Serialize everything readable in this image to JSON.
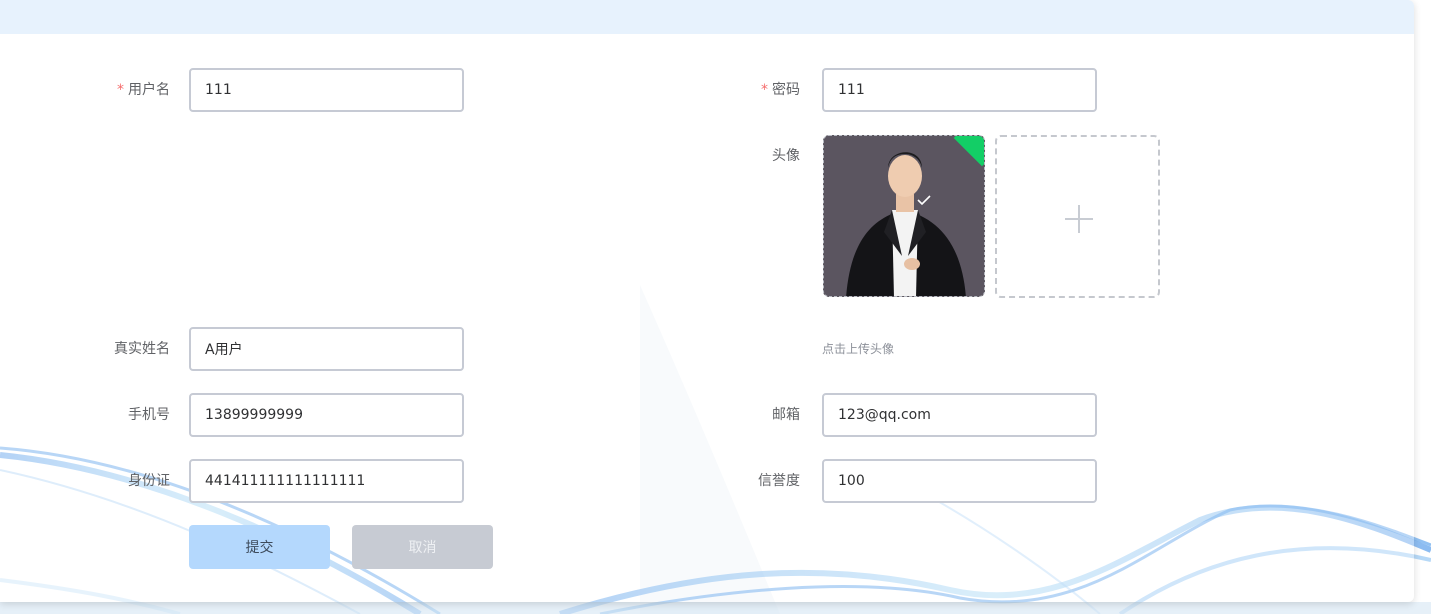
{
  "form": {
    "username": {
      "label": "用户名",
      "required_mark": "*",
      "value": "111"
    },
    "password": {
      "label": "密码",
      "required_mark": "*",
      "value": "111"
    },
    "avatar": {
      "label": "头像",
      "hint": "点击上传头像",
      "uploaded_icon": "check-icon",
      "add_icon": "plus-icon"
    },
    "realname": {
      "label": "真实姓名",
      "value": "A用户"
    },
    "phone": {
      "label": "手机号",
      "value": "13899999999"
    },
    "email": {
      "label": "邮箱",
      "value": "123@qq.com"
    },
    "idcard": {
      "label": "身份证",
      "value": "441411111111111111"
    },
    "credit": {
      "label": "信誉度",
      "value": "100"
    }
  },
  "buttons": {
    "submit": "提交",
    "cancel": "取消"
  },
  "colors": {
    "header": "#e7f2fd",
    "required": "#f56c6c",
    "submit_bg": "#b4d8fd",
    "cancel_bg": "#c7cbd3",
    "success_corner": "#13ce66",
    "wave": "#5aa2ee"
  }
}
